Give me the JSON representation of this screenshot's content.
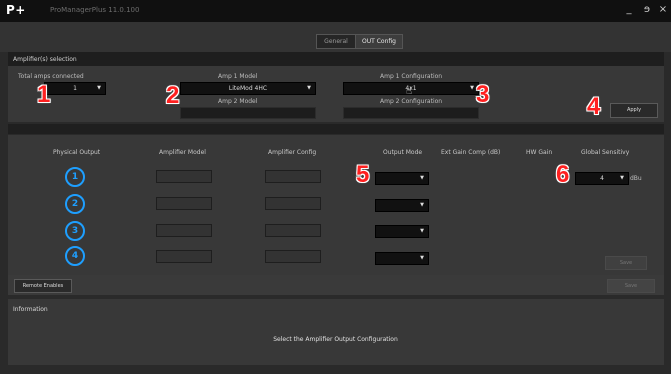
{
  "window": {
    "logo": "P+",
    "title": "ProManagerPlus 11.0.100",
    "minimize": "_",
    "restore": "ɘ",
    "close": "×"
  },
  "tabs": [
    {
      "label": "General",
      "selected": false
    },
    {
      "label": "OUT Config",
      "selected": true
    }
  ],
  "amp_selection": {
    "header": "Amplifier(s) selection",
    "total_label": "Total amps connected",
    "total_value": "1",
    "amp1_model_label": "Amp 1 Model",
    "amp1_model_value": "LiteMod 4HC",
    "amp2_model_label": "Amp 2 Model",
    "amp1_config_label": "Amp 1 Configuration",
    "amp1_config_value": "4x1",
    "amp2_config_label": "Amp 2 Configuration",
    "apply_label": "Apply"
  },
  "outputs": {
    "columns": {
      "physical": "Physical Output",
      "model": "Amplifier Model",
      "config": "Amplifier Config",
      "mode": "Output Mode",
      "ext_gain": "Ext Gain Comp (dB)",
      "hw_gain": "HW Gain",
      "sensitivity": "Global Sensitivy"
    },
    "rows": [
      {
        "icon": "1"
      },
      {
        "icon": "2"
      },
      {
        "icon": "3"
      },
      {
        "icon": "4"
      }
    ],
    "sensitivity_value": "4",
    "sensitivity_unit": "dBu",
    "save_label": "Save",
    "remote_enable_label": "Remote Enables",
    "send_label": "Save"
  },
  "info": {
    "header": "Information",
    "message": "Select the Amplifier Output Configuration"
  },
  "callouts": [
    "1",
    "2",
    "3",
    "4",
    "5",
    "6"
  ],
  "colors": {
    "accent": "#1e9fff",
    "callout": "#ff2020"
  }
}
